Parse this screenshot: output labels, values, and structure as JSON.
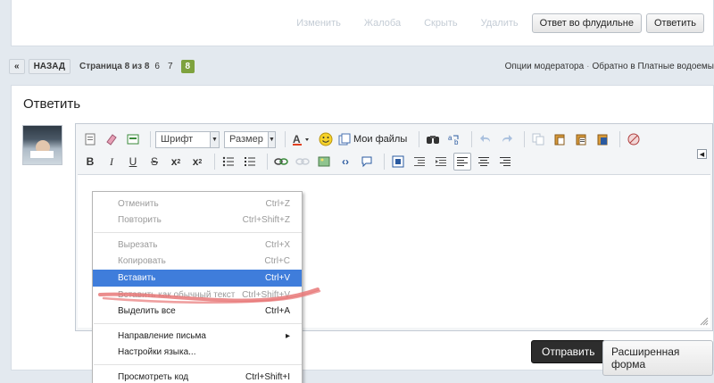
{
  "post_actions": {
    "links": [
      "Изменить",
      "Жалоба",
      "Скрыть",
      "Удалить"
    ],
    "flood_button": "Ответ во флудильне",
    "reply_button": "Ответить"
  },
  "pager": {
    "prev": "«",
    "back": "НАЗАД",
    "page_text": "Страница 8 из 8",
    "pages": [
      "6",
      "7"
    ],
    "current": "8"
  },
  "mod_links": {
    "options": "Опции модератора",
    "separator": "·",
    "back_to": "Обратно в Платные водоемы"
  },
  "reply": {
    "title": "Ответить",
    "font_combo": "Шрифт",
    "size_combo": "Размер",
    "my_files": "Мои файлы",
    "send_button": "Отправить",
    "advanced_button": "Расширенная форма"
  },
  "context_menu": {
    "items": [
      {
        "label": "Отменить",
        "shortcut": "Ctrl+Z",
        "disabled": true
      },
      {
        "label": "Повторить",
        "shortcut": "Ctrl+Shift+Z",
        "disabled": true
      },
      {
        "label": "Вырезать",
        "shortcut": "Ctrl+X",
        "disabled": true
      },
      {
        "label": "Копировать",
        "shortcut": "Ctrl+C",
        "disabled": true
      },
      {
        "label": "Вставить",
        "shortcut": "Ctrl+V",
        "selected": true
      },
      {
        "label": "Вставить как обычный текст",
        "shortcut": "Ctrl+Shift+V",
        "disabled": true
      },
      {
        "label": "Выделить все",
        "shortcut": "Ctrl+A"
      },
      {
        "label": "Направление письма",
        "shortcut": "▸"
      },
      {
        "label": "Настройки языка...",
        "shortcut": ""
      },
      {
        "label": "Просмотреть код",
        "shortcut": "Ctrl+Shift+I"
      }
    ]
  },
  "colors": {
    "accent_page": "#7ea23e",
    "menu_highlight": "#3f7ddb",
    "scribble": "#e87878"
  }
}
